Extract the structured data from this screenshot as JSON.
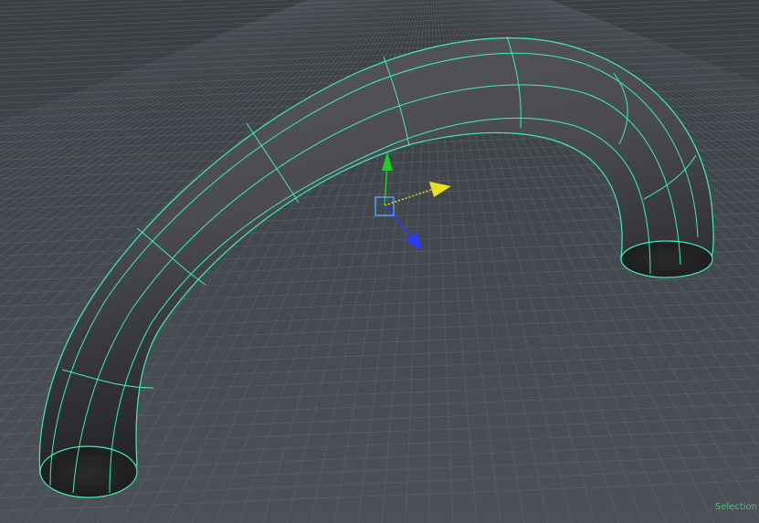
{
  "viewport": {
    "status_text": "Selection"
  },
  "colors": {
    "background_top": "#3a3f44",
    "background_bottom": "#4b5157",
    "grid_line": "#6c747b",
    "mesh_shade_dark": "#1e1f21",
    "mesh_shade_mid": "#55575a",
    "wireframe": "#3df0b4",
    "gizmo_y_axis": "#22cc22",
    "gizmo_x_axis": "#e8e020",
    "gizmo_z_axis": "#2b3cff",
    "gizmo_center": "#4fa6ff"
  },
  "icons": [
    "move-manipulator-icon"
  ]
}
